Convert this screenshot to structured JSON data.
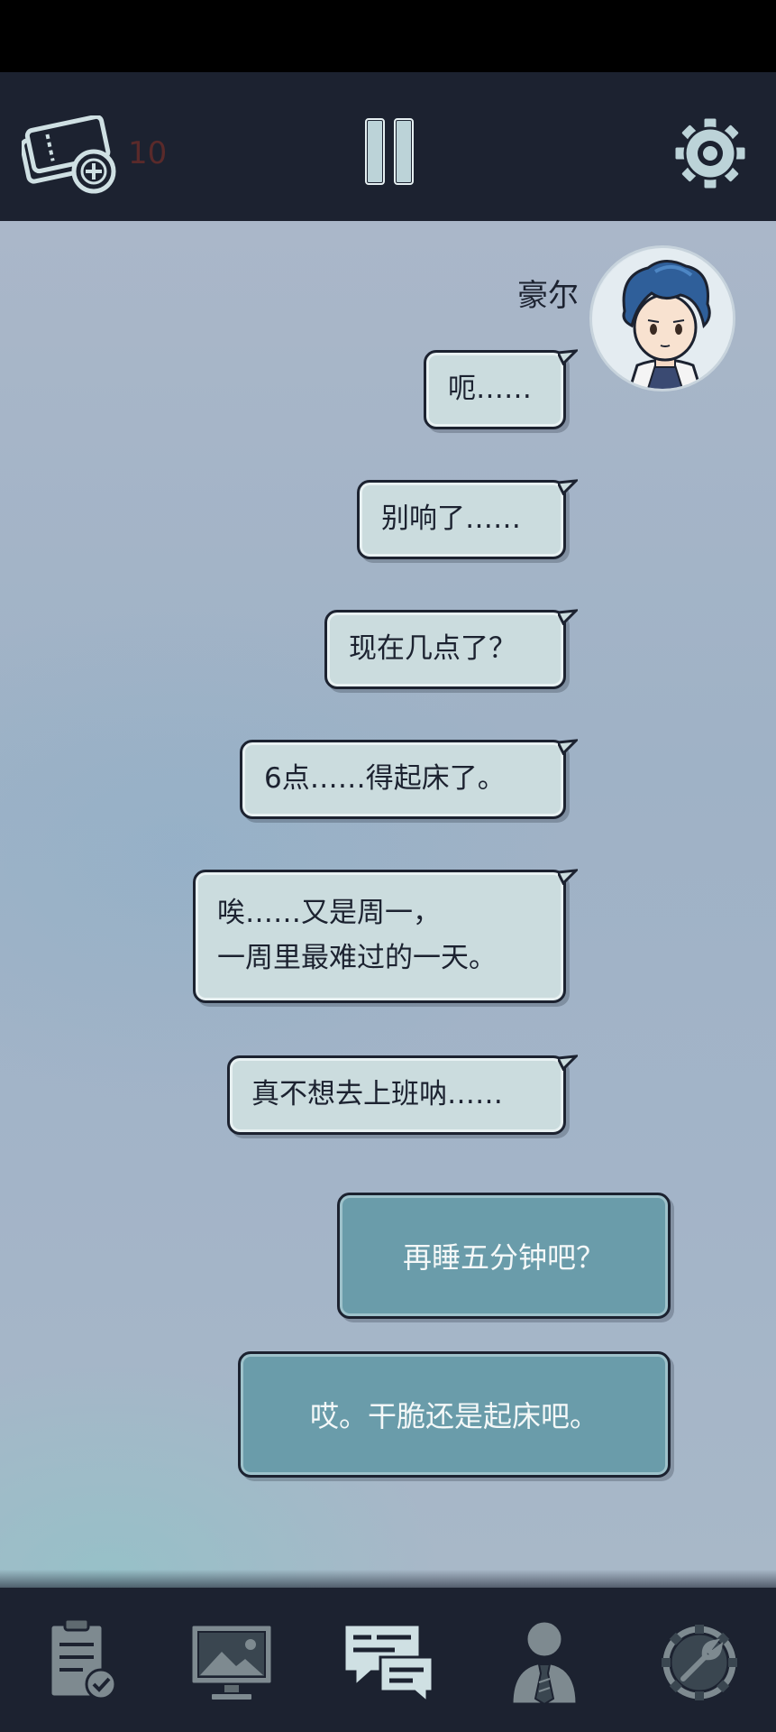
{
  "header": {
    "ticket_count": "10"
  },
  "speaker": {
    "name": "豪尔"
  },
  "messages": [
    {
      "text": "呃……"
    },
    {
      "text": "别响了……"
    },
    {
      "text": "现在几点了？"
    },
    {
      "text": "6点……得起床了。"
    },
    {
      "line1": "唉……又是周一，",
      "line2": "一周里最难过的一天。"
    },
    {
      "text": "真不想去上班呐……"
    }
  ],
  "choices": [
    {
      "label": "再睡五分钟吧？"
    },
    {
      "label": "哎。干脆还是起床吧。"
    }
  ],
  "nav": {
    "items": [
      {
        "icon": "clipboard-check-icon"
      },
      {
        "icon": "monitor-image-icon"
      },
      {
        "icon": "chat-bubbles-icon",
        "active": true
      },
      {
        "icon": "person-tie-icon"
      },
      {
        "icon": "gear-wrench-icon"
      }
    ]
  },
  "colors": {
    "bar": "#1c2230",
    "bubble": "#cbdcde",
    "choice": "#6a9caa",
    "ticket_count": "#5a2a2a"
  }
}
